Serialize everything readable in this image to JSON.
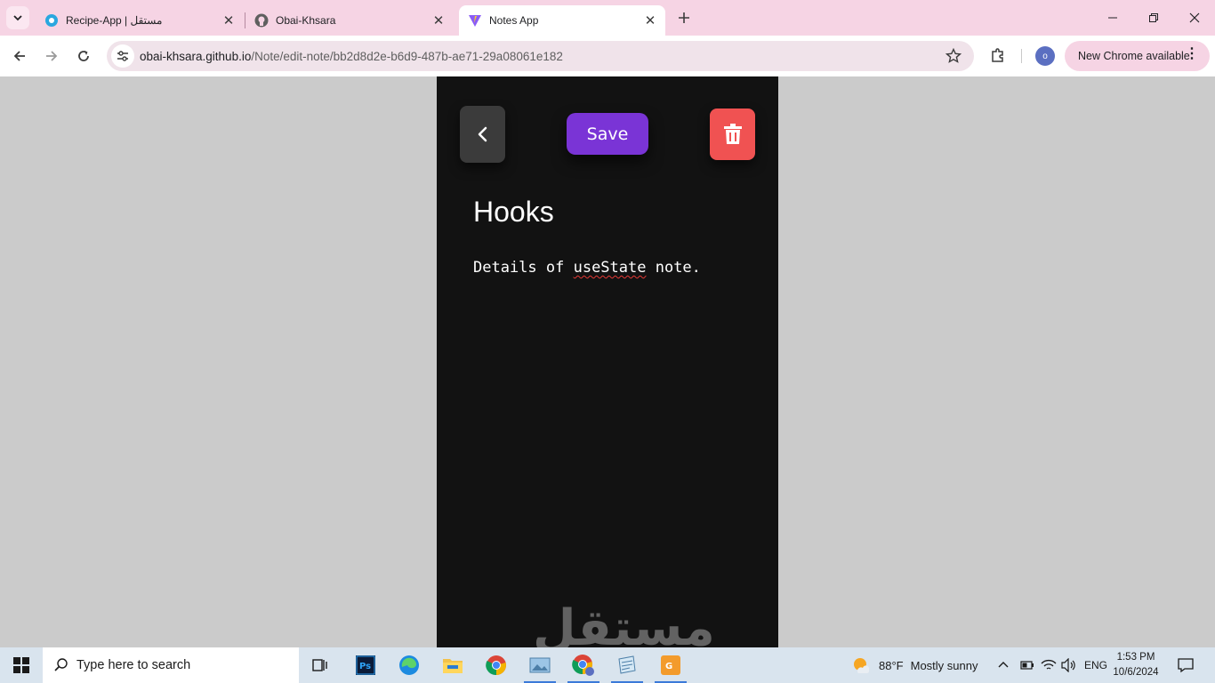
{
  "browser": {
    "tabs": [
      {
        "title": "Recipe-App | مستقل",
        "icon": "mostaql-favicon-icon"
      },
      {
        "title": "Obai-Khsara",
        "icon": "github-icon"
      },
      {
        "title": "Notes App",
        "icon": "vite-icon",
        "active": true
      }
    ],
    "address": {
      "host": "obai-khsara.github.io",
      "path": "/Note/edit-note/bb2d8d2e-b6d9-487b-ae71-29a08061e182"
    },
    "profile_initial": "o",
    "update_label": "New Chrome available"
  },
  "note": {
    "save_label": "Save",
    "title": "Hooks",
    "body_before": "Details of ",
    "body_misspelled": "useState",
    "body_after": " note."
  },
  "watermark": "مستقل",
  "taskbar": {
    "search_placeholder": "Type here to search",
    "weather_temp": "88°F",
    "weather_desc": "Mostly sunny",
    "lang": "ENG",
    "time": "1:53 PM",
    "date": "10/6/2024"
  },
  "colors": {
    "tab_strip": "#f6d4e4",
    "save_button": "#7a34d6",
    "delete_button": "#f05252",
    "back_button": "#3b3b3b",
    "app_background": "#121212"
  }
}
